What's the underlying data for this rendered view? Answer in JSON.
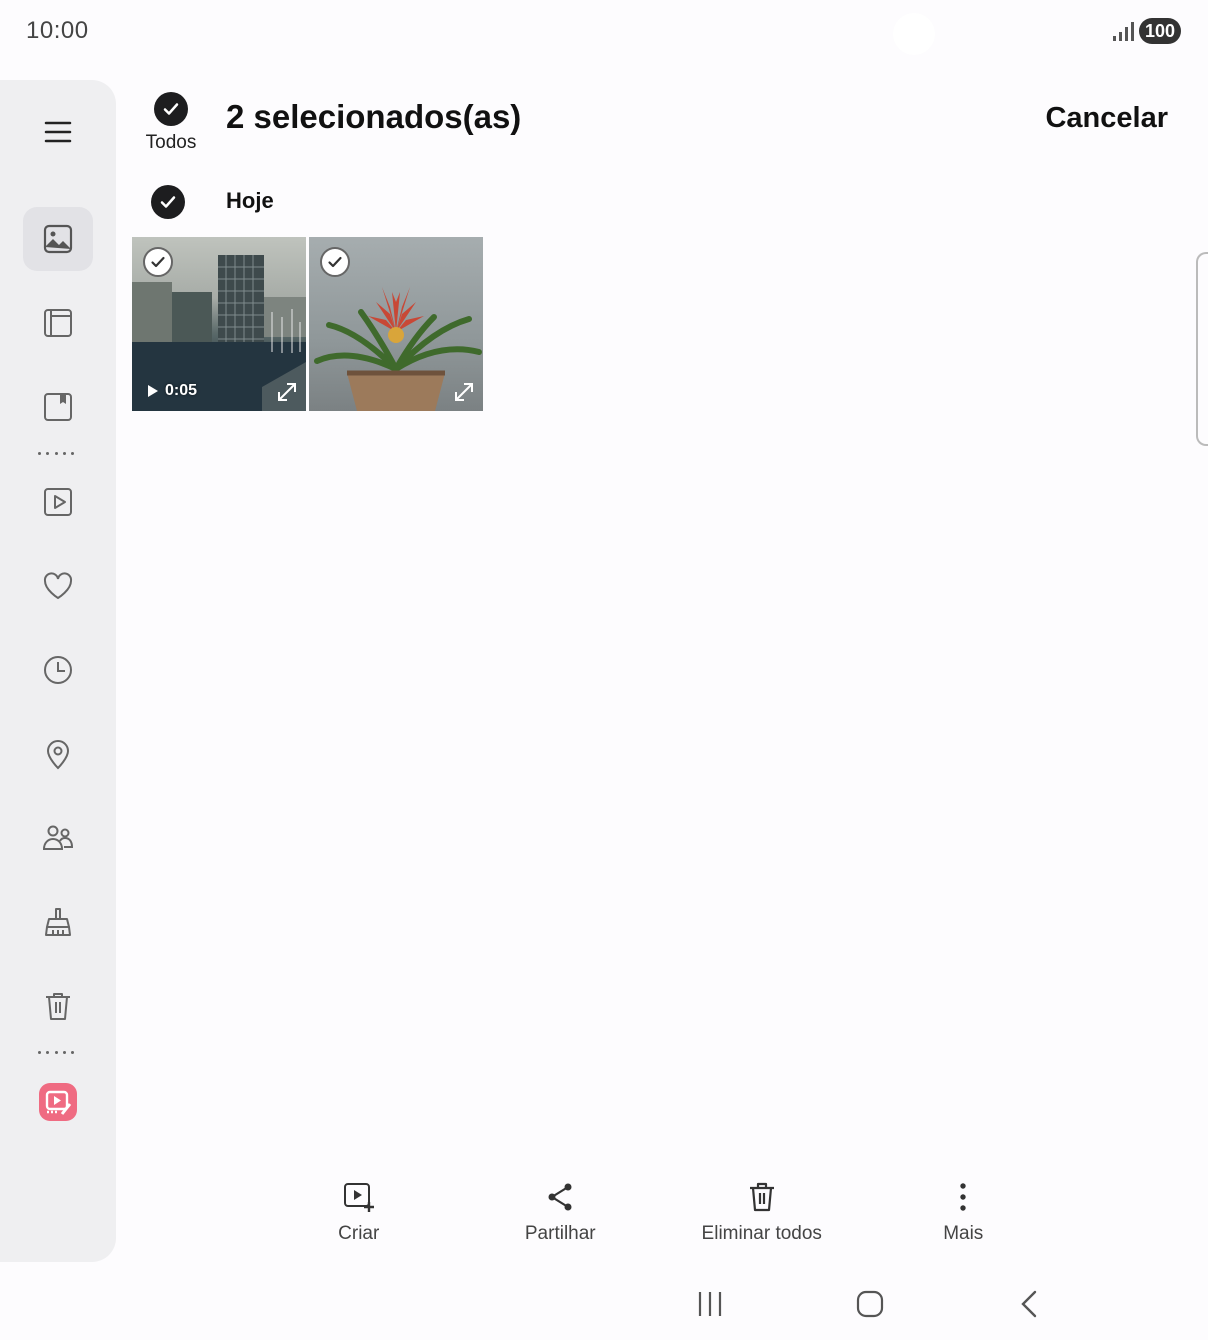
{
  "status_bar": {
    "time": "10:00",
    "battery": "100"
  },
  "header": {
    "select_all_label": "Todos",
    "title": "2 selecionados(as)",
    "cancel_label": "Cancelar"
  },
  "group": {
    "date_label": "Hoje"
  },
  "items": [
    {
      "type": "video",
      "duration": "0:05",
      "selected": true
    },
    {
      "type": "image",
      "selected": true
    }
  ],
  "actions": [
    {
      "label": "Criar",
      "icon": "create-icon"
    },
    {
      "label": "Partilhar",
      "icon": "share-icon"
    },
    {
      "label": "Eliminar todos",
      "icon": "delete-icon"
    },
    {
      "label": "Mais",
      "icon": "more-icon"
    }
  ],
  "sidebar": {
    "items": [
      {
        "icon": "menu-icon"
      },
      {
        "icon": "pictures-icon",
        "active": true
      },
      {
        "icon": "albums-icon"
      },
      {
        "icon": "stories-icon"
      },
      {
        "icon": "videos-icon"
      },
      {
        "icon": "favorites-icon"
      },
      {
        "icon": "recent-icon"
      },
      {
        "icon": "locations-icon"
      },
      {
        "icon": "shared-icon"
      },
      {
        "icon": "clean-out-icon"
      },
      {
        "icon": "trash-icon"
      },
      {
        "icon": "video-editor-app-icon"
      }
    ]
  },
  "colors": {
    "accent_dark": "#1d1d1f",
    "sidebar_bg": "#efeff1",
    "app_icon": "#ef6b82"
  }
}
